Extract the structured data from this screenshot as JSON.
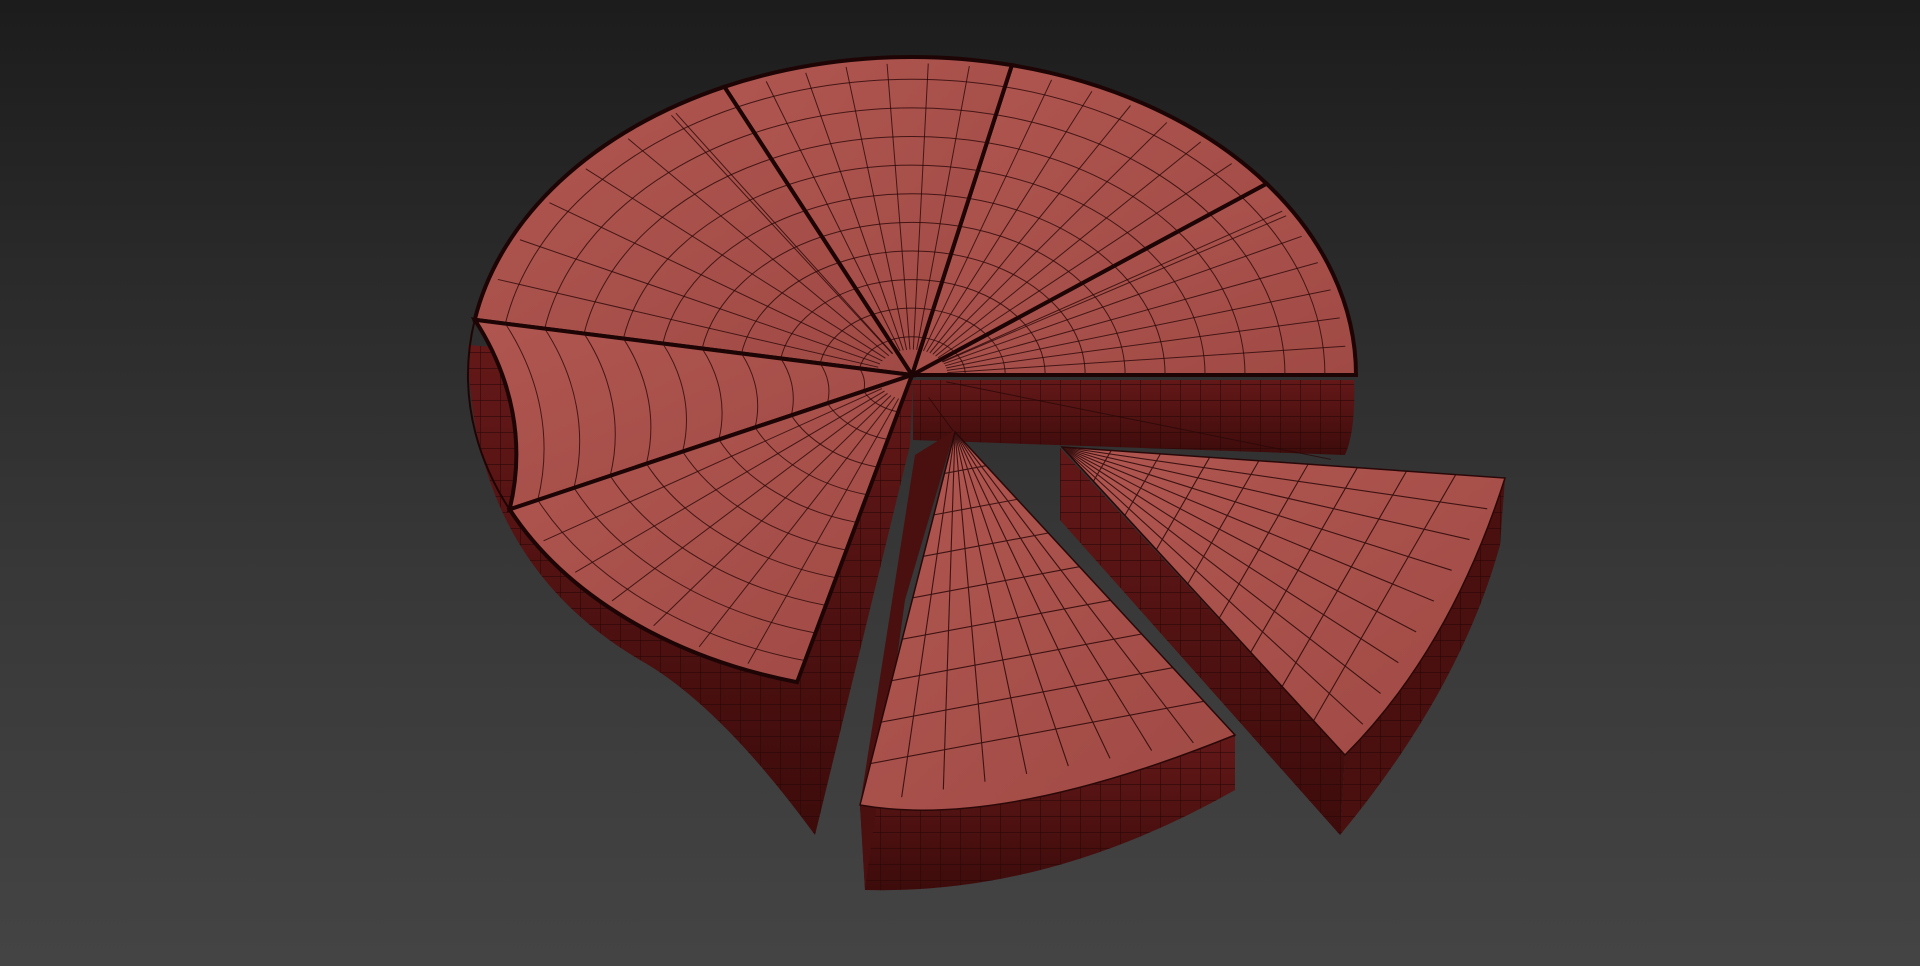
{
  "scene": {
    "subject": "pie-chart-3d-model",
    "render_mode": "wireframe-on-shaded",
    "colors": {
      "background_top": "#1c1c1c",
      "background_bottom": "#444444",
      "top_face": "#a64f4a",
      "top_face_light": "#b45a54",
      "side_face": "#5a1414",
      "side_face_dark": "#3f0c0c",
      "wire": "#2a0808"
    },
    "slices": [
      {
        "name": "slice-1",
        "state": "attached"
      },
      {
        "name": "slice-2",
        "state": "attached"
      },
      {
        "name": "slice-3",
        "state": "attached"
      },
      {
        "name": "slice-4",
        "state": "attached"
      },
      {
        "name": "slice-5",
        "state": "attached"
      },
      {
        "name": "slice-6",
        "state": "attached"
      },
      {
        "name": "slice-7",
        "state": "exploded"
      },
      {
        "name": "slice-8",
        "state": "exploded"
      }
    ]
  }
}
